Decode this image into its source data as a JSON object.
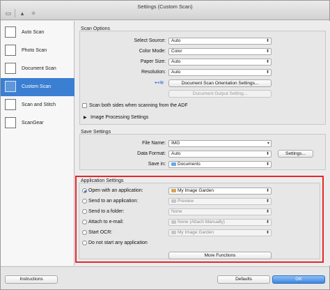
{
  "window": {
    "title": "Settings (Custom Scan)"
  },
  "sidebar": {
    "items": [
      {
        "label": "Auto Scan",
        "icon": "auto-scan-icon",
        "selected": false
      },
      {
        "label": "Photo Scan",
        "icon": "photo-scan-icon",
        "selected": false
      },
      {
        "label": "Document Scan",
        "icon": "document-scan-icon",
        "selected": false
      },
      {
        "label": "Custom Scan",
        "icon": "custom-scan-icon",
        "selected": true
      },
      {
        "label": "Scan and Stitch",
        "icon": "scan-and-stitch-icon",
        "selected": false
      },
      {
        "label": "ScanGear",
        "icon": "scangear-icon",
        "selected": false
      }
    ]
  },
  "scan_options": {
    "title": "Scan Options",
    "select_source": {
      "label": "Select Source:",
      "value": "Auto"
    },
    "color_mode": {
      "label": "Color Mode:",
      "value": "Color"
    },
    "paper_size": {
      "label": "Paper Size:",
      "value": "Auto"
    },
    "resolution": {
      "label": "Resolution:",
      "value": "Auto"
    },
    "orientation_button": "Document Scan Orientation Settings...",
    "output_button": "Document Output Setting...",
    "scan_both_sides": "Scan both sides when scanning from the ADF",
    "image_processing": "Image Processing Settings"
  },
  "save_settings": {
    "title": "Save Settings",
    "file_name": {
      "label": "File Name:",
      "value": "IMG"
    },
    "data_format": {
      "label": "Data Format:",
      "value": "Auto"
    },
    "settings_button": "Settings...",
    "save_in": {
      "label": "Save in:",
      "value": "Documents"
    }
  },
  "application_settings": {
    "title": "Application Settings",
    "options": [
      {
        "label": "Open with an application:",
        "value": "My Image Garden",
        "selected": true,
        "enabled": true
      },
      {
        "label": "Send to an application:",
        "value": "Preview",
        "selected": false,
        "enabled": false
      },
      {
        "label": "Send to a folder:",
        "value": "None",
        "selected": false,
        "enabled": false
      },
      {
        "label": "Attach to e-mail:",
        "value": "None (Attach Manually)",
        "selected": false,
        "enabled": false
      },
      {
        "label": "Start OCR:",
        "value": "My Image Garden",
        "selected": false,
        "enabled": false
      }
    ],
    "no_app": "Do not start any application",
    "more_functions": "More Functions"
  },
  "footer": {
    "instructions": "Instructions",
    "defaults": "Defaults",
    "ok": "OK"
  },
  "colors": {
    "selection": "#3b7fd2",
    "highlight_box": "#e5262b"
  }
}
